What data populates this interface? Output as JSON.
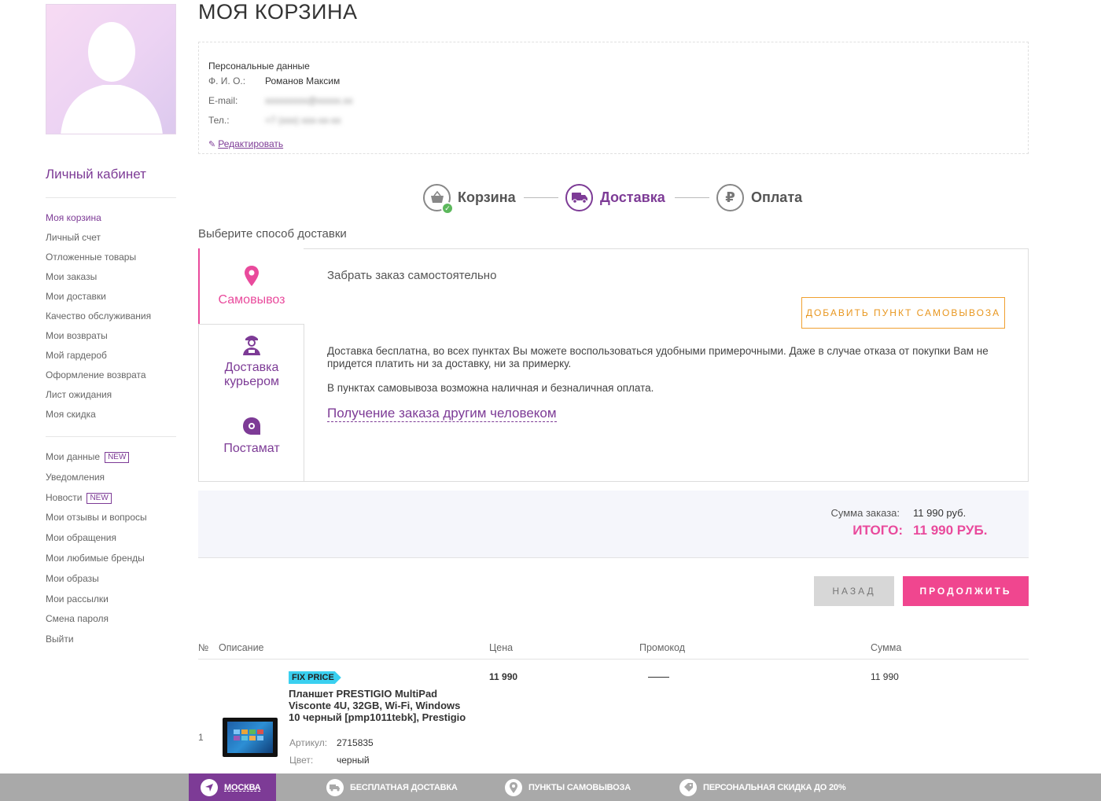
{
  "page_title": "МОЯ КОРЗИНА",
  "sidebar": {
    "title": "Личный кабинет",
    "menu": [
      {
        "label": "Моя корзина",
        "active": true
      },
      {
        "label": "Личный счет"
      },
      {
        "label": "Отложенные товары"
      },
      {
        "label": "Мои заказы"
      },
      {
        "label": "Мои доставки"
      },
      {
        "label": "Качество обслуживания"
      },
      {
        "label": "Мои возвраты"
      },
      {
        "label": "Мой гардероб"
      },
      {
        "label": "Оформление возврата"
      },
      {
        "label": "Лист ожидания"
      },
      {
        "label": "Моя скидка"
      }
    ],
    "menu2": [
      {
        "label": "Мои данные",
        "badge": "NEW"
      },
      {
        "label": "Уведомления"
      },
      {
        "label": "Новости",
        "badge": "NEW"
      },
      {
        "label": "Мои отзывы и вопросы"
      },
      {
        "label": "Мои обращения"
      },
      {
        "label": "Мои любимые бренды"
      },
      {
        "label": "Мои образы"
      },
      {
        "label": "Мои рассылки"
      },
      {
        "label": "Смена пароля"
      },
      {
        "label": "Выйти"
      }
    ]
  },
  "personal": {
    "title": "Персональные данные",
    "name_label": "Ф. И. О.:",
    "name_value": "Романов Максим",
    "email_label": "E-mail:",
    "email_value": "xxxxxxxxx@xxxxx.xx",
    "phone_label": "Тел.:",
    "phone_value": "+7 (xxx) xxx-xx-xx",
    "edit_label": "Редактировать"
  },
  "steps": [
    {
      "label": "Корзина",
      "icon": "basket-icon",
      "done": true
    },
    {
      "label": "Доставка",
      "icon": "truck-icon",
      "active": true
    },
    {
      "label": "Оплата",
      "icon": "ruble-icon"
    }
  ],
  "delivery": {
    "title": "Выберите способ доставки",
    "tabs": [
      {
        "label": "Самовывоз",
        "icon": "map-pin-icon",
        "active": true
      },
      {
        "label": "Доставка курьером",
        "icon": "courier-icon"
      },
      {
        "label": "Постамат",
        "icon": "postamat-icon"
      }
    ],
    "pickup_heading": "Забрать заказ самостоятельно",
    "add_pickup_button": "ДОБАВИТЬ ПУНКТ САМОВЫВОЗА",
    "text1": "Доставка бесплатна, во всех пунктах Вы можете воспользоваться удобными примерочными. Даже в случае отказа от покупки Вам не придется платить ни за доставку, ни за примерку.",
    "text2": "В пунктах самовывоза возможна наличная и безналичная оплата.",
    "other_person_link": "Получение заказа другим человеком"
  },
  "summary": {
    "sum_label": "Сумма заказа:",
    "sum_value": "11 990 руб.",
    "total_label": "ИТОГО:",
    "total_value": "11 990 РУБ."
  },
  "buttons": {
    "back": "НАЗАД",
    "continue": "ПРОДОЛЖИТЬ"
  },
  "table": {
    "headers": {
      "num": "№",
      "desc": "Описание",
      "price": "Цена",
      "promo": "Промокод",
      "sum": "Сумма"
    },
    "rows": [
      {
        "num": "1",
        "tag": "FIX PRICE",
        "name": "Планшет PRESTIGIO MultiPad Visconte 4U, 32GB, Wi-Fi, Windows 10 черный [pmp1011tebk], Prestigio",
        "article_label": "Артикул:",
        "article_value": "2715835",
        "color_label": "Цвет:",
        "color_value": "черный",
        "price": "11 990",
        "promo": "——",
        "sum": "11 990"
      }
    ]
  },
  "bottom_bar": {
    "city": "МОСКВА",
    "free_delivery": "БЕСПЛАТНАЯ ДОСТАВКА",
    "pickup_points": "ПУНКТЫ САМОВЫВОЗА",
    "discount": "ПЕРСОНАЛЬНАЯ СКИДКА ДО 20%"
  },
  "colors": {
    "brand_purple": "#7d3b96",
    "accent_pink": "#e94a9c",
    "button_pink": "#f0468f",
    "orange": "#e8961e",
    "success_green": "#5cb85c"
  }
}
